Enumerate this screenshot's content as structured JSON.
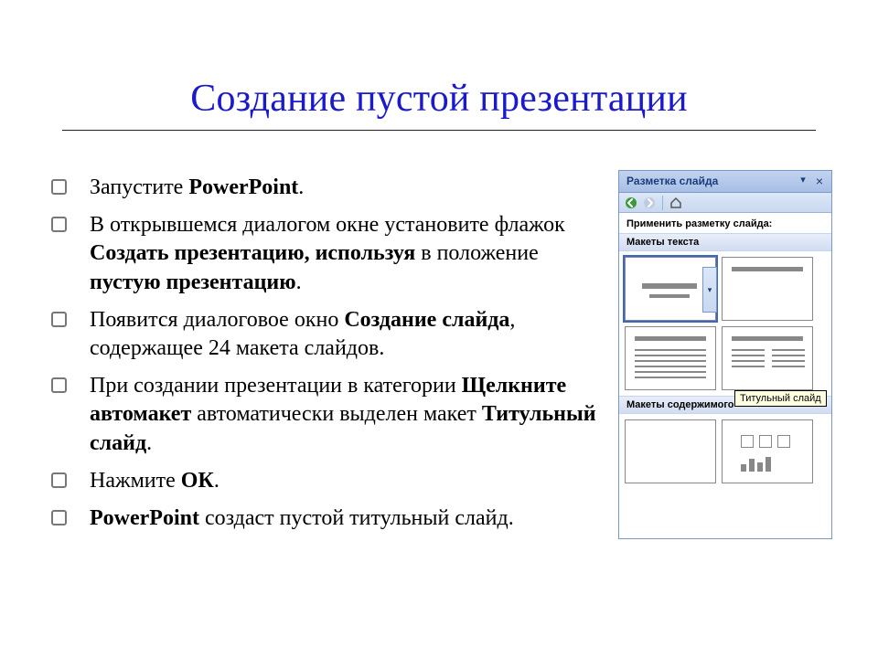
{
  "title": "Создание пустой презентации",
  "bullets": [
    {
      "parts": [
        {
          "t": "Запустите ",
          "b": false
        },
        {
          "t": "PowerPoint",
          "b": true
        },
        {
          "t": ".",
          "b": false
        }
      ]
    },
    {
      "parts": [
        {
          "t": "В открывшемся диалогом окне установите флажок ",
          "b": false
        },
        {
          "t": "Создать презентацию, используя",
          "b": true
        },
        {
          "t": " в положение ",
          "b": false
        },
        {
          "t": "пустую презентацию",
          "b": true
        },
        {
          "t": ".",
          "b": false
        }
      ]
    },
    {
      "parts": [
        {
          "t": "Появится диалоговое окно ",
          "b": false
        },
        {
          "t": "Создание слайда",
          "b": true
        },
        {
          "t": ", содержащее 24 макета слайдов.",
          "b": false
        }
      ]
    },
    {
      "parts": [
        {
          "t": "При создании презентации в категории ",
          "b": false
        },
        {
          "t": "Щелкните автомакет",
          "b": true
        },
        {
          "t": " автоматически выделен макет ",
          "b": false
        },
        {
          "t": "Титульный слайд",
          "b": true
        },
        {
          "t": ".",
          "b": false
        }
      ]
    },
    {
      "parts": [
        {
          "t": "Нажмите ",
          "b": false
        },
        {
          "t": "ОК",
          "b": true
        },
        {
          "t": ".",
          "b": false
        }
      ]
    },
    {
      "parts": [
        {
          "t": "PowerPoint",
          "b": true
        },
        {
          "t": " создаст пустой титульный слайд.",
          "b": false
        }
      ]
    }
  ],
  "taskpane": {
    "header_title": "Разметка слайда",
    "instruction": "Применить разметку слайда:",
    "group_text": "Макеты текста",
    "group_content": "Макеты содержимого",
    "tooltip": "Титульный слайд"
  }
}
